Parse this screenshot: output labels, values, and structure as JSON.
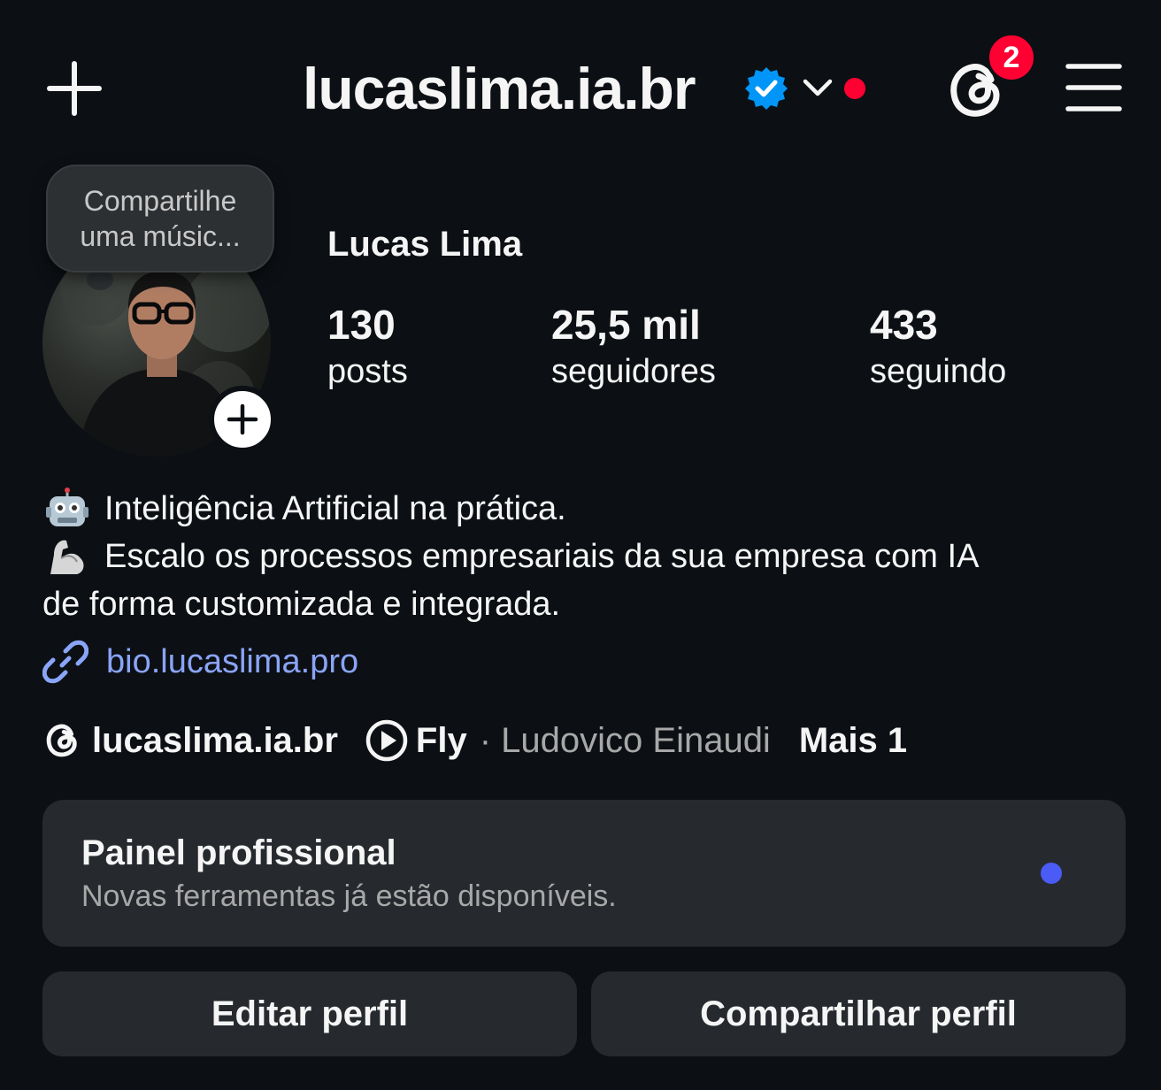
{
  "header": {
    "username": "lucaslima.ia.br",
    "notification_count": "2",
    "icons": [
      "create-plus-icon",
      "verified-badge-icon",
      "chevron-down-icon",
      "threads-icon",
      "hamburger-menu-icon"
    ]
  },
  "profile": {
    "note": "Compartilhe uma músic...",
    "full_name": "Lucas Lima",
    "stats": [
      {
        "value": "130",
        "label": "posts"
      },
      {
        "value": "25,5 mil",
        "label": "seguidores"
      },
      {
        "value": "433",
        "label": "seguindo"
      }
    ]
  },
  "bio": {
    "line1": "Inteligência Artificial na prática.",
    "line2": "Escalo os processos empresariais da sua empresa com IA",
    "line3": "de forma customizada e integrada.",
    "link": "bio.lucaslima.pro"
  },
  "chips": {
    "threads_handle": "lucaslima.ia.br",
    "song_title": "Fly",
    "song_artist": "· Ludovico Einaudi",
    "more": "Mais 1"
  },
  "pro_panel": {
    "title": "Painel profissional",
    "subtitle": "Novas ferramentas já estão disponíveis."
  },
  "buttons": {
    "edit": "Editar perfil",
    "share": "Compartilhar perfil"
  },
  "colors": {
    "background": "#0c1014",
    "verified": "#0095f6",
    "red_dot": "#ff0033",
    "badge": "#ff0033",
    "link": "#8aa4f8",
    "panel_dot": "#4a5cf5",
    "surface": "#262a2f"
  }
}
